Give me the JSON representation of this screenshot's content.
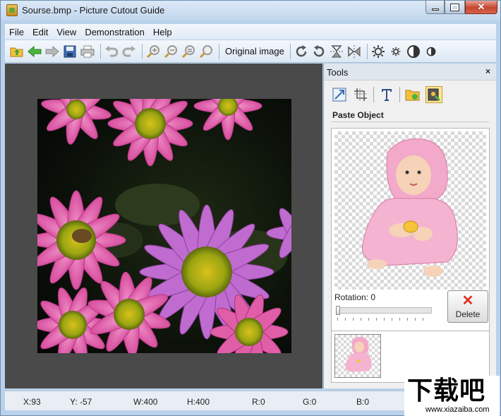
{
  "window": {
    "title": "Sourse.bmp - Picture Cutout Guide"
  },
  "menu": [
    "File",
    "Edit",
    "View",
    "Demonstration",
    "Help"
  ],
  "toolbar": {
    "original_image_label": "Original image"
  },
  "tools": {
    "title": "Tools",
    "close": "×",
    "section": "Paste Object",
    "rotation_label": "Rotation: 0",
    "rotation_value": 0,
    "delete_label": "Delete"
  },
  "status": {
    "x": "X:93",
    "y": "Y: -57",
    "w": "W:400",
    "h": "H:400",
    "r": "R:0",
    "g": "G:0",
    "b": "B:0"
  },
  "watermark": {
    "text": "下载吧",
    "url": "www.xiazaiba.com"
  },
  "colors": {
    "accent": "#4a4a4a",
    "delete": "#e0301e",
    "active_tool": "#ffe79a"
  }
}
